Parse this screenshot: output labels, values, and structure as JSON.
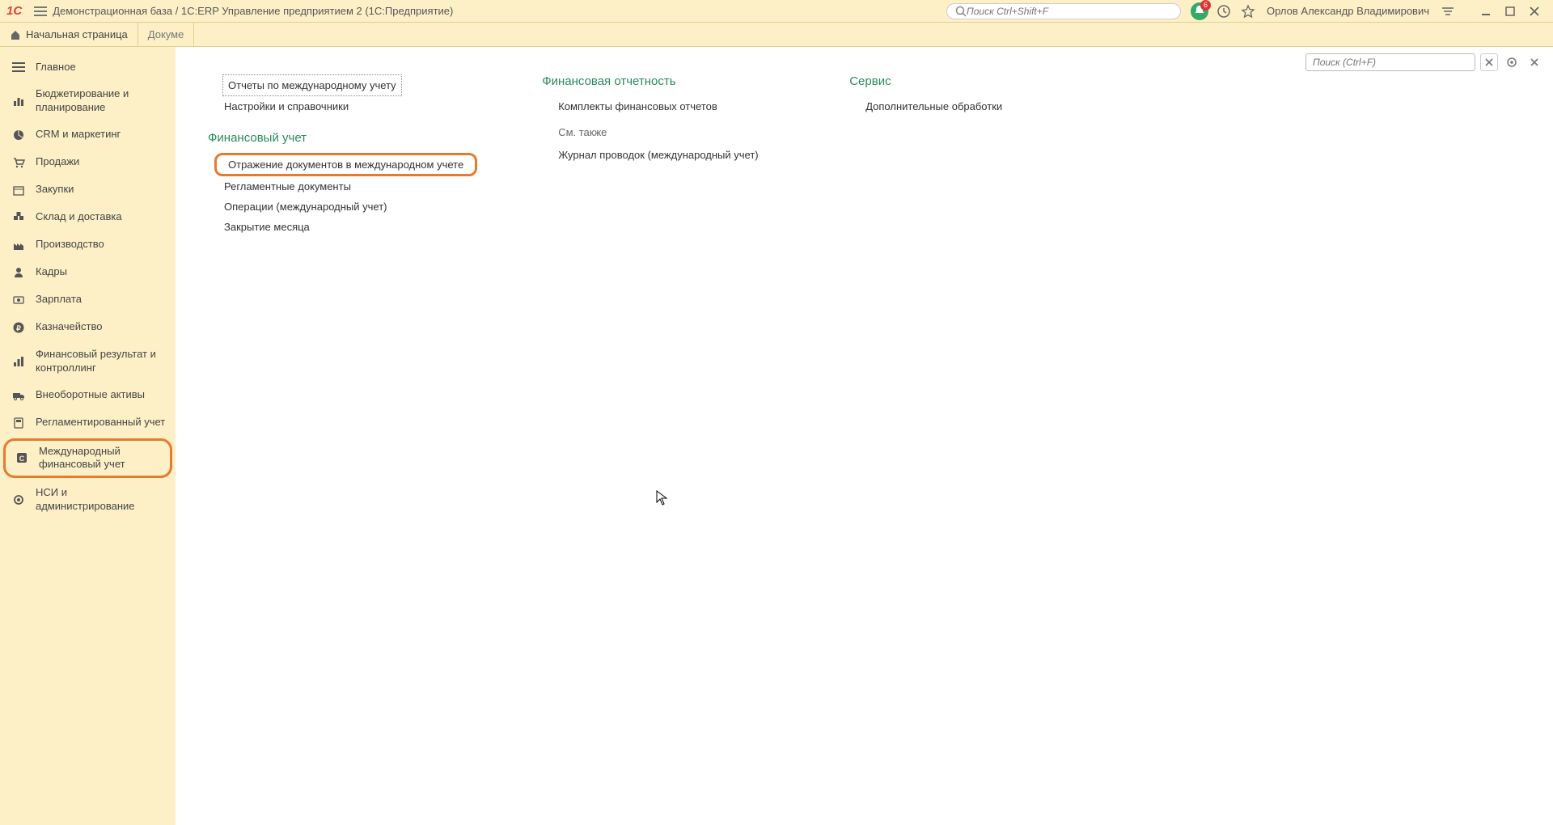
{
  "topbar": {
    "app_title": "Демонстрационная база / 1C:ERP Управление предприятием 2  (1С:Предприятие)",
    "search_placeholder": "Поиск Ctrl+Shift+F",
    "notif_count": "6",
    "user_name": "Орлов Александр Владимирович"
  },
  "tabs": [
    {
      "label": "Начальная страница",
      "icon": "home"
    },
    {
      "label": "Докуме",
      "icon": ""
    }
  ],
  "sidebar": {
    "items": [
      {
        "label": "Главное",
        "icon": "menu"
      },
      {
        "label": "Бюджетирование и планирование",
        "icon": "chart"
      },
      {
        "label": "CRM и маркетинг",
        "icon": "pie"
      },
      {
        "label": "Продажи",
        "icon": "cart"
      },
      {
        "label": "Закупки",
        "icon": "box"
      },
      {
        "label": "Склад и доставка",
        "icon": "warehouse"
      },
      {
        "label": "Производство",
        "icon": "factory"
      },
      {
        "label": "Кадры",
        "icon": "person"
      },
      {
        "label": "Зарплата",
        "icon": "money"
      },
      {
        "label": "Казначейство",
        "icon": "ruble"
      },
      {
        "label": "Финансовый результат и контроллинг",
        "icon": "bars"
      },
      {
        "label": "Внеоборотные активы",
        "icon": "truck"
      },
      {
        "label": "Регламентированный учет",
        "icon": "calc"
      },
      {
        "label": "Международный финансовый учет",
        "icon": "globe",
        "highlighted": true
      },
      {
        "label": "НСИ и администрирование",
        "icon": "gear"
      }
    ]
  },
  "main": {
    "search_placeholder": "Поиск (Ctrl+F)",
    "col1": {
      "group1_items": [
        {
          "label": "Отчеты по международному учету",
          "selected": true
        },
        {
          "label": "Настройки и справочники"
        }
      ],
      "section": "Финансовый учет",
      "items": [
        {
          "label": "Отражение документов в международном учете",
          "highlighted": true
        },
        {
          "label": "Регламентные документы"
        },
        {
          "label": "Операции (международный учет)"
        },
        {
          "label": "Закрытие месяца"
        }
      ]
    },
    "col2": {
      "section1": "Финансовая отчетность",
      "items1": [
        {
          "label": "Комплекты финансовых отчетов"
        }
      ],
      "subhead": "См. также",
      "items2": [
        {
          "label": "Журнал проводок (международный учет)"
        }
      ]
    },
    "col3": {
      "section": "Сервис",
      "items": [
        {
          "label": "Дополнительные обработки"
        }
      ]
    }
  }
}
